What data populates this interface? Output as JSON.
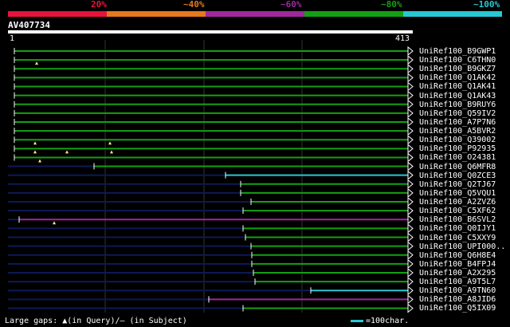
{
  "legend": {
    "percent_labels": [
      "20%",
      "~40%",
      "~60%",
      "~80%",
      "~100%"
    ],
    "colors": [
      "#e6143c",
      "#e6781e",
      "#a0289c",
      "#14a014",
      "#28c8d2"
    ]
  },
  "query": {
    "id": "AV407734",
    "start": "1",
    "end": "413"
  },
  "footer": {
    "gaps_text": "Large gaps: ▲(in Query)/– (in Subject)",
    "scale_text": "=100char."
  },
  "hits": [
    {
      "name": "UniRef100_B9GWP1",
      "color": "green"
    },
    {
      "name": "UniRef100_C6THN0",
      "color": "green"
    },
    {
      "name": "UniRef100_B9GKZ7",
      "color": "green"
    },
    {
      "name": "UniRef100_Q1AK42",
      "color": "green"
    },
    {
      "name": "UniRef100_Q1AK41",
      "color": "green"
    },
    {
      "name": "UniRef100_Q1AK43",
      "color": "green"
    },
    {
      "name": "UniRef100_B9RUY6",
      "color": "green"
    },
    {
      "name": "UniRef100_Q59IV2",
      "color": "green"
    },
    {
      "name": "UniRef100_A7P7N6",
      "color": "green"
    },
    {
      "name": "UniRef100_A5BVR2",
      "color": "green"
    },
    {
      "name": "UniRef100_Q39002",
      "color": "green"
    },
    {
      "name": "UniRef100_P92935",
      "color": "green"
    },
    {
      "name": "UniRef100_O24381",
      "color": "green"
    },
    {
      "name": "UniRef100_Q6MFR8",
      "color": "green"
    },
    {
      "name": "UniRef100_Q0ZCE3",
      "color": "cyan"
    },
    {
      "name": "UniRef100_Q2TJ67",
      "color": "green"
    },
    {
      "name": "UniRef100_Q5VQU1",
      "color": "green"
    },
    {
      "name": "UniRef100_A2ZVZ6",
      "color": "green"
    },
    {
      "name": "UniRef100_C5XF62",
      "color": "green"
    },
    {
      "name": "UniRef100_B6SVL2",
      "color": "purple"
    },
    {
      "name": "UniRef100_Q0IJY1",
      "color": "green"
    },
    {
      "name": "UniRef100_C5XXY9",
      "color": "green"
    },
    {
      "name": "UniRef100_UPI000..",
      "color": "green"
    },
    {
      "name": "UniRef100_Q6H8E4",
      "color": "green"
    },
    {
      "name": "UniRef100_B4FPJ4",
      "color": "green"
    },
    {
      "name": "UniRef100_A2X295",
      "color": "green"
    },
    {
      "name": "UniRef100_A9T5L7",
      "color": "green"
    },
    {
      "name": "UniRef100_A9TN60",
      "color": "cyan"
    },
    {
      "name": "UniRef100_A8JID6",
      "color": "purple"
    },
    {
      "name": "UniRef100_Q5IX09",
      "color": "green"
    }
  ]
}
